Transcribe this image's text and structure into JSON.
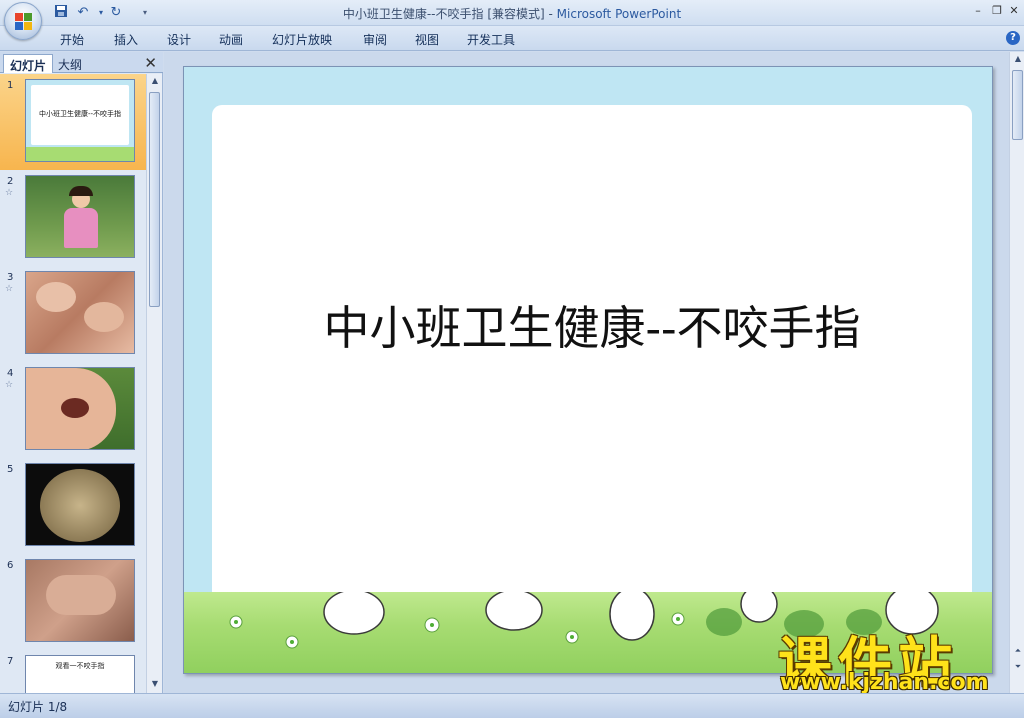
{
  "window": {
    "title": "中小班卫生健康--不咬手指 [兼容模式] - ",
    "app_name": "Microsoft PowerPoint"
  },
  "ribbon": {
    "tabs": [
      "开始",
      "插入",
      "设计",
      "动画",
      "幻灯片放映",
      "审阅",
      "视图",
      "开发工具"
    ]
  },
  "panel": {
    "tabs": [
      "幻灯片",
      "大纲"
    ],
    "active_tab": "幻灯片"
  },
  "thumbnails": [
    {
      "num": "1",
      "text": "中小班卫生健康--不咬手指",
      "selected": true
    },
    {
      "num": "2"
    },
    {
      "num": "3"
    },
    {
      "num": "4"
    },
    {
      "num": "5"
    },
    {
      "num": "6"
    },
    {
      "num": "7",
      "text": "观看一不咬手指"
    }
  ],
  "slide": {
    "title": "中小班卫生健康--不咬手指"
  },
  "watermark": {
    "logo": "课件站",
    "url": "www.kjzhan.com"
  },
  "status": {
    "slide_info": "幻灯片 1/8"
  },
  "icons": {
    "office": "office-button-icon",
    "save": "save-icon",
    "undo": "undo-icon",
    "redo": "redo-icon"
  },
  "colors": {
    "selection": "#f7b54e",
    "watermark": "#ffe21a",
    "slide_frame": "#bfe6f3",
    "grass": "#a7dc72"
  }
}
